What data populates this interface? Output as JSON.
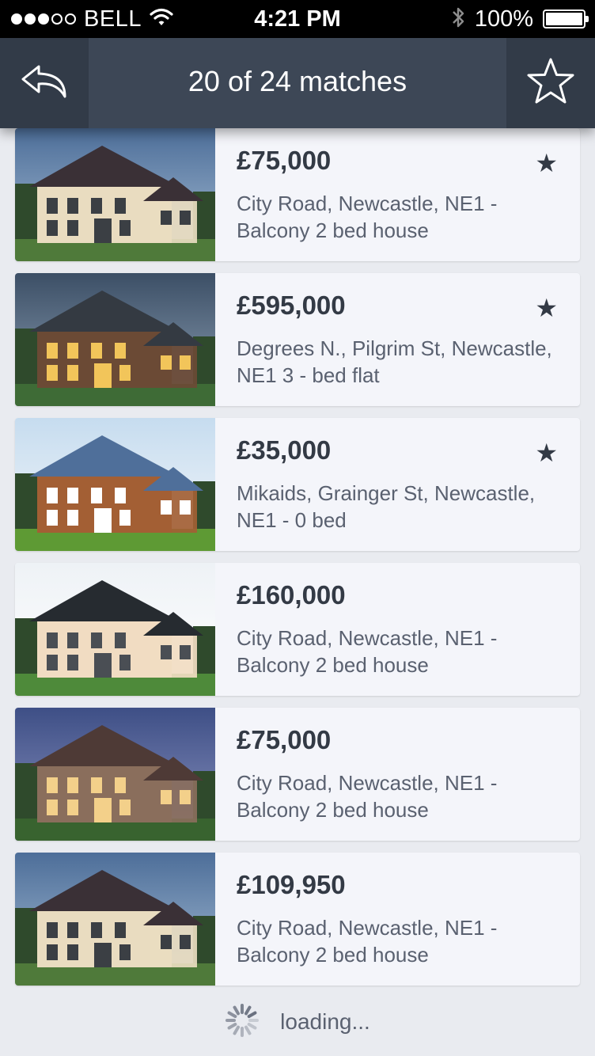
{
  "status_bar": {
    "carrier": "BELL",
    "time": "4:21 PM",
    "battery": "100%",
    "battery_level": 1.0,
    "signal_bars_filled": 3,
    "signal_bars_total": 5,
    "icons": [
      "wifi-icon",
      "bluetooth-icon",
      "battery-icon"
    ]
  },
  "nav": {
    "title": "20 of 24 matches",
    "back_icon": "back-arrow-icon",
    "favorite_icon": "star-outline-icon"
  },
  "listings": [
    {
      "price": "£75,000",
      "address": "City Road, Newcastle, NE1 - Balcony 2 bed house",
      "starred": true,
      "image": "house-photo"
    },
    {
      "price": "£595,000",
      "address": "Degrees N., Pilgrim St, Newcastle, NE1 3 - bed flat",
      "starred": true,
      "image": "house-photo"
    },
    {
      "price": "£35,000",
      "address": "Mikaids, Grainger St, Newcastle, NE1 - 0 bed",
      "starred": true,
      "image": "house-photo"
    },
    {
      "price": "£160,000",
      "address": "City Road, Newcastle, NE1 - Balcony 2 bed house",
      "starred": false,
      "image": "house-photo"
    },
    {
      "price": "£75,000",
      "address": "City Road, Newcastle, NE1 - Balcony 2 bed house",
      "starred": false,
      "image": "house-photo"
    },
    {
      "price": "£109,950",
      "address": "City Road, Newcastle, NE1 - Balcony 2 bed house",
      "starred": false,
      "image": "house-photo"
    }
  ],
  "loading": {
    "text": "loading...",
    "icon": "spinner-icon"
  },
  "colors": {
    "nav_bg": "#3d4756",
    "page_bg": "#e9ebf0",
    "card_bg": "#f4f5fa",
    "text_dark": "#333a45"
  }
}
